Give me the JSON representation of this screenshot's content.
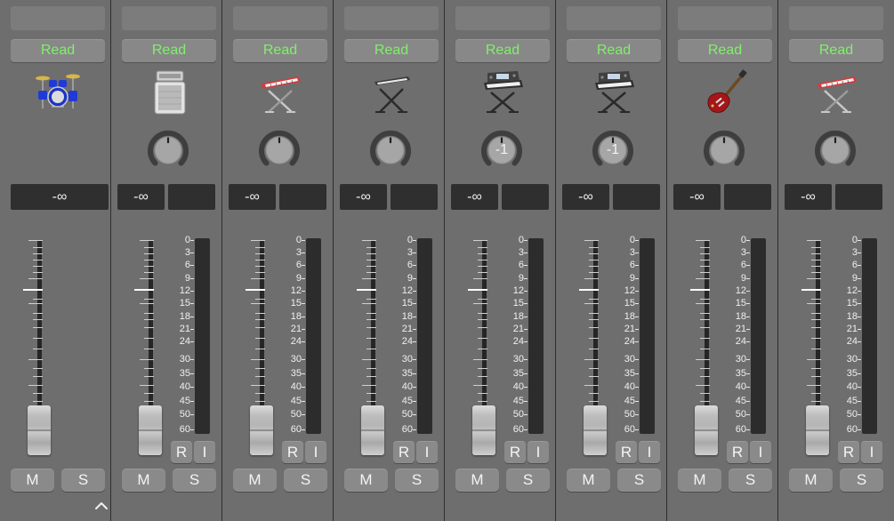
{
  "strips": [
    {
      "id": "1",
      "automation": "Read",
      "instrument": "drum-kit-icon",
      "pan": "",
      "level": "-∞",
      "stereo_meter": false,
      "has_input_rec": false,
      "mute": "M",
      "solo": "S"
    },
    {
      "id": "2",
      "automation": "Read",
      "instrument": "amp-icon",
      "pan": "",
      "level": "-∞",
      "stereo_meter": true,
      "has_input_rec": true,
      "rec": "R",
      "input": "I",
      "mute": "M",
      "solo": "S"
    },
    {
      "id": "3",
      "automation": "Read",
      "instrument": "keyboard-red-icon",
      "pan": "",
      "level": "-∞",
      "stereo_meter": true,
      "has_input_rec": true,
      "rec": "R",
      "input": "I",
      "mute": "M",
      "solo": "S"
    },
    {
      "id": "4",
      "automation": "Read",
      "instrument": "keyboard-stand-icon",
      "pan": "",
      "level": "-∞",
      "stereo_meter": true,
      "has_input_rec": true,
      "rec": "R",
      "input": "I",
      "mute": "M",
      "solo": "S"
    },
    {
      "id": "5",
      "automation": "Read",
      "instrument": "synth-workstation-icon",
      "pan": "-1",
      "level": "-∞",
      "stereo_meter": true,
      "has_input_rec": true,
      "rec": "R",
      "input": "I",
      "mute": "M",
      "solo": "S"
    },
    {
      "id": "6",
      "automation": "Read",
      "instrument": "synth-workstation-icon",
      "pan": "-1",
      "level": "-∞",
      "stereo_meter": true,
      "has_input_rec": true,
      "rec": "R",
      "input": "I",
      "mute": "M",
      "solo": "S"
    },
    {
      "id": "7",
      "automation": "Read",
      "instrument": "electric-guitar-icon",
      "pan": "",
      "level": "-∞",
      "stereo_meter": true,
      "has_input_rec": true,
      "rec": "R",
      "input": "I",
      "mute": "M",
      "solo": "S"
    },
    {
      "id": "8",
      "automation": "Read",
      "instrument": "keyboard-red-icon",
      "pan": "",
      "level": "-∞",
      "stereo_meter": true,
      "has_input_rec": true,
      "rec": "R",
      "input": "I",
      "mute": "M",
      "solo": "S"
    }
  ],
  "meter_scale": [
    "0",
    "3",
    "6",
    "9",
    "12",
    "15",
    "18",
    "21",
    "24",
    "30",
    "35",
    "40",
    "45",
    "50",
    "60"
  ],
  "colors": {
    "automation_read": "#80f06a",
    "strip_bg": "#6e6e6e",
    "button_bg": "#8a8a8a"
  },
  "expand_icon": "chevron-up-icon"
}
